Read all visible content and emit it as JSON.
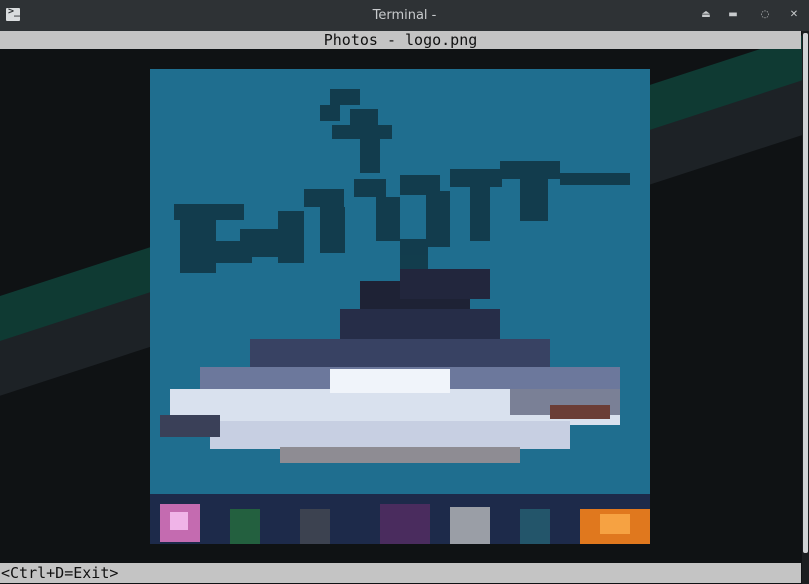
{
  "window": {
    "title": "Terminal -",
    "icon": "terminal-icon",
    "buttons": [
      "eject-icon",
      "minimize-icon",
      "restore-icon",
      "close-icon"
    ]
  },
  "viewer": {
    "header": "Photos - logo.png",
    "footer": "<Ctrl+D=Exit>",
    "image_description_icon": "pixelated-logo-image"
  },
  "colors": {
    "titlebar": "#2e3235",
    "terminal_bg": "#0f1214",
    "stripe_green": "#0f3a33",
    "bar": "#c4c4c4",
    "image_bg": "#1f6e8f"
  }
}
